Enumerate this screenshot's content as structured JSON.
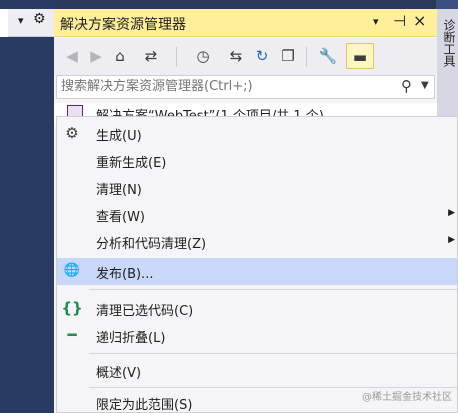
{
  "left_toolbar": {
    "dropdown_glyph": "▾",
    "gear_glyph": "⚙"
  },
  "right_tab": {
    "label": "诊断工具"
  },
  "explorer": {
    "title": "解决方案资源管理器",
    "title_buttons": {
      "dropdown": "▾",
      "pin": "⊣",
      "close": "×"
    },
    "toolbar": {
      "back": "◀",
      "forward": "▶",
      "home": "⌂",
      "switch_views": "⇄",
      "history": "◷",
      "sync": "⇆",
      "refresh": "↻",
      "collapse_all": "❐",
      "properties": "🔧",
      "preview": "▬"
    },
    "search": {
      "placeholder": "搜索解决方案资源管理器(Ctrl+;)"
    },
    "tree": {
      "solution_label": "解决方案“WebTest”(1 个项目/共 1 个)"
    }
  },
  "context_menu": {
    "items": [
      {
        "label": "生成(U)",
        "icon": "build-icon",
        "glyph": "⚙",
        "submenu": false,
        "highlighted": false
      },
      {
        "label": "重新生成(E)",
        "icon": "",
        "glyph": "",
        "submenu": false,
        "highlighted": false
      },
      {
        "label": "清理(N)",
        "icon": "",
        "glyph": "",
        "submenu": false,
        "highlighted": false
      },
      {
        "label": "查看(W)",
        "icon": "",
        "glyph": "",
        "submenu": true,
        "highlighted": false
      },
      {
        "label": "分析和代码清理(Z)",
        "icon": "",
        "glyph": "",
        "submenu": true,
        "highlighted": false
      },
      {
        "label": "发布(B)...",
        "icon": "globe-icon",
        "glyph": "🌐",
        "submenu": false,
        "highlighted": true
      },
      {
        "label": "清理已选代码(C)",
        "icon": "braces-icon",
        "glyph": "{}",
        "submenu": false,
        "highlighted": false
      },
      {
        "label": "递归折叠(L)",
        "icon": "collapse-icon",
        "glyph": "━",
        "submenu": false,
        "highlighted": false
      },
      {
        "label": "概述(V)",
        "icon": "",
        "glyph": "",
        "submenu": false,
        "highlighted": false
      },
      {
        "label": "限定为此范围(S)",
        "icon": "",
        "glyph": "",
        "submenu": false,
        "highlighted": false
      }
    ],
    "submenu_glyph": "▶"
  },
  "watermark": {
    "text": "@稀土掘金技术社区"
  },
  "colors": {
    "title_bar": "#ffef9b",
    "highlight": "#c9d7f8",
    "braces": "#1e8c4e",
    "globe": "#1a6bbf"
  }
}
